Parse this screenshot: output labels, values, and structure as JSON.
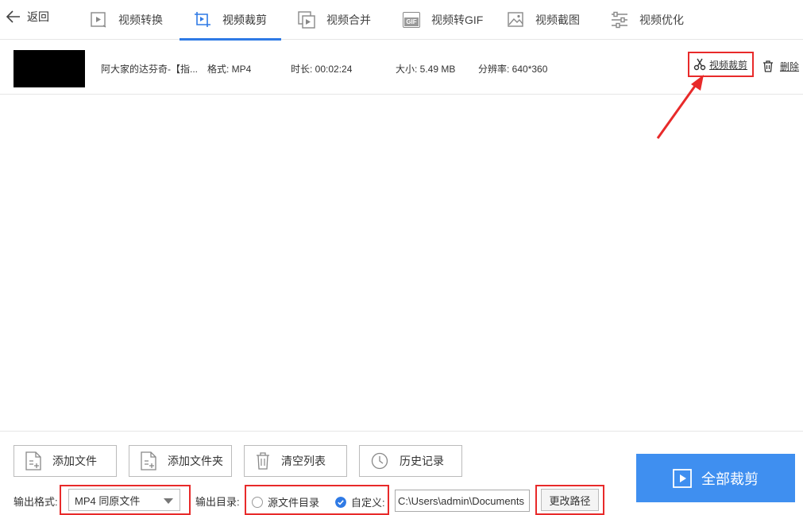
{
  "topbar": {
    "back_label": "返回",
    "tabs": [
      {
        "label": "视频转换",
        "icon": "video-convert-icon"
      },
      {
        "label": "视频裁剪",
        "icon": "video-crop-icon",
        "active": true
      },
      {
        "label": "视频合并",
        "icon": "video-merge-icon"
      },
      {
        "label": "视频转GIF",
        "icon": "gif-icon"
      },
      {
        "label": "视频截图",
        "icon": "screenshot-icon"
      },
      {
        "label": "视频优化",
        "icon": "optimize-icon"
      }
    ],
    "gif_badge": "GIF"
  },
  "file": {
    "name": "阿大家的达芬奇-【指...",
    "format": "格式: MP4",
    "duration": "时长: 00:02:24",
    "size": "大小: 5.49 MB",
    "resolution": "分辨率: 640*360",
    "crop_label": "视频裁剪",
    "delete_label": "删除"
  },
  "toolbar": {
    "add_file": "添加文件",
    "add_folder": "添加文件夹",
    "clear_list": "清空列表",
    "history": "历史记录"
  },
  "output": {
    "format_label": "输出格式:",
    "format_value": "MP4 同原文件",
    "dir_label": "输出目录:",
    "source_dir": "源文件目录",
    "custom": "自定义:",
    "path_value": "C:\\Users\\admin\\Documents",
    "change_path": "更改路径"
  },
  "primary_button": "全部裁剪",
  "colors": {
    "accent": "#2f7ae5",
    "button_blue": "#3f8ff0",
    "highlight_red": "#e82a2a"
  }
}
